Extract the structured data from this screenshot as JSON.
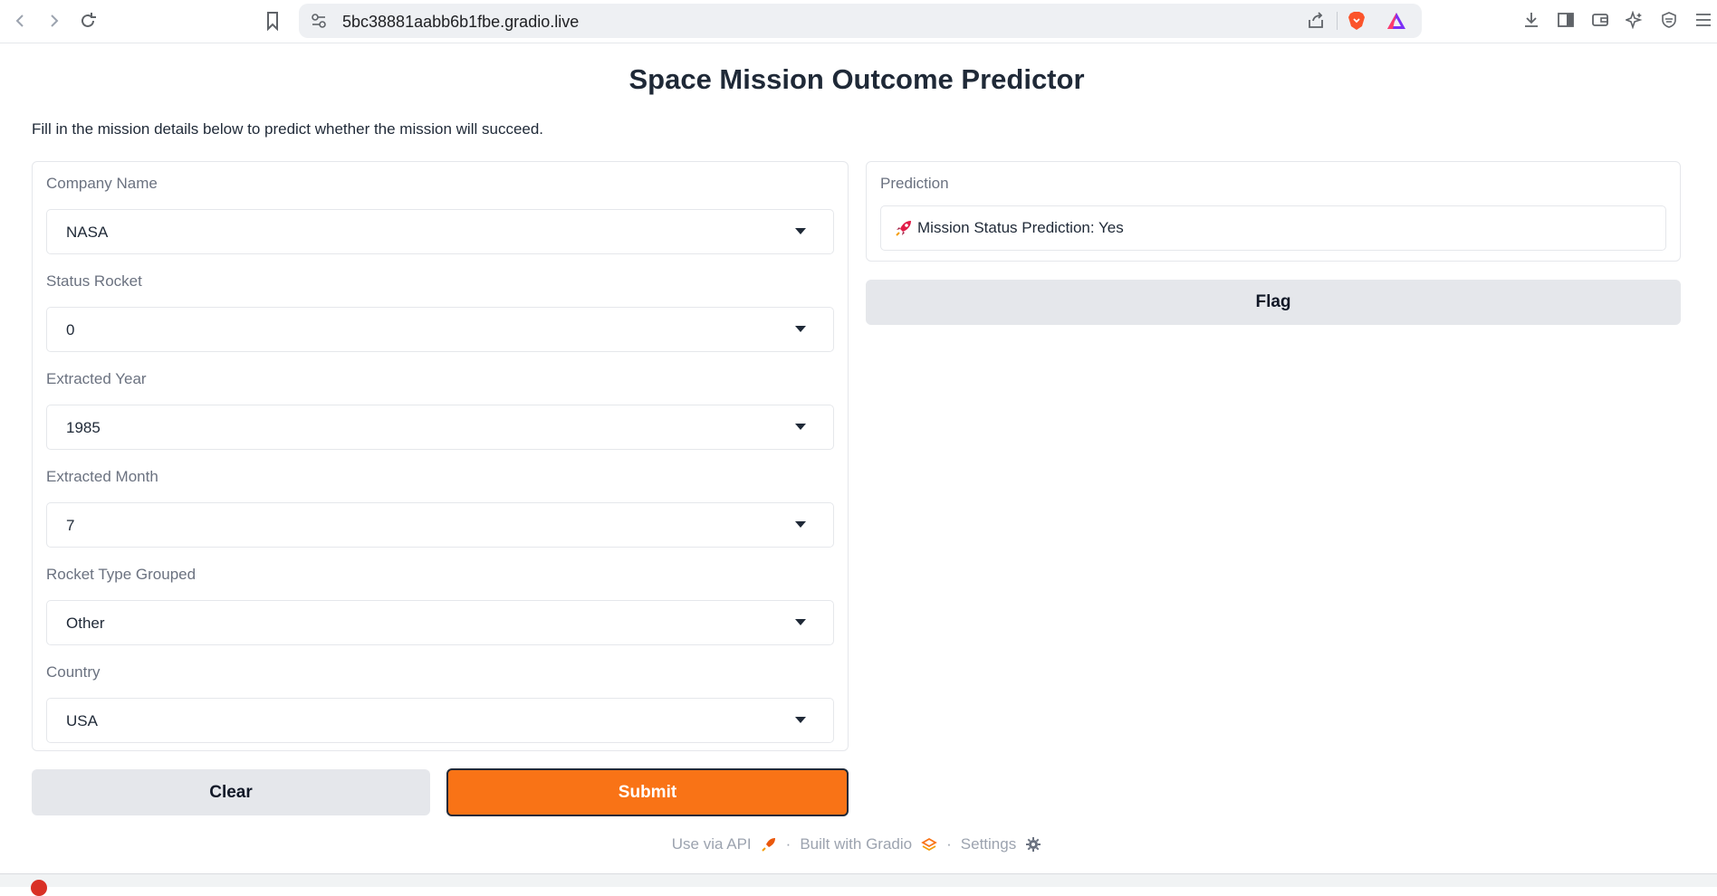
{
  "browser": {
    "url": "5bc38881aabb6b1fbe.gradio.live",
    "icons": [
      "back-icon",
      "forward-icon",
      "reload-icon",
      "bookmark-icon",
      "site-info-icon",
      "share-icon",
      "brave-shield-icon",
      "brave-rewards-icon",
      "download-icon",
      "sidebar-icon",
      "wallet-icon",
      "leo-ai-icon",
      "vpn-icon",
      "menu-icon"
    ]
  },
  "app": {
    "title": "Space Mission Outcome Predictor",
    "description": "Fill in the mission details below to predict whether the mission will succeed.",
    "fields": [
      {
        "label": "Company Name",
        "value": "NASA"
      },
      {
        "label": "Status Rocket",
        "value": "0"
      },
      {
        "label": "Extracted Year",
        "value": "1985"
      },
      {
        "label": "Extracted Month",
        "value": "7"
      },
      {
        "label": "Rocket Type Grouped",
        "value": "Other"
      },
      {
        "label": "Country",
        "value": "USA"
      }
    ],
    "buttons": {
      "clear": "Clear",
      "submit": "Submit",
      "flag": "Flag"
    },
    "prediction": {
      "label": "Prediction",
      "text": "Mission Status Prediction: Yes",
      "icon": "rocket-icon"
    },
    "colors": {
      "submit": "#f97316",
      "secondary_button": "#e5e7eb"
    },
    "footer": {
      "api": "Use via API",
      "built": "Built with Gradio",
      "settings": "Settings"
    }
  }
}
